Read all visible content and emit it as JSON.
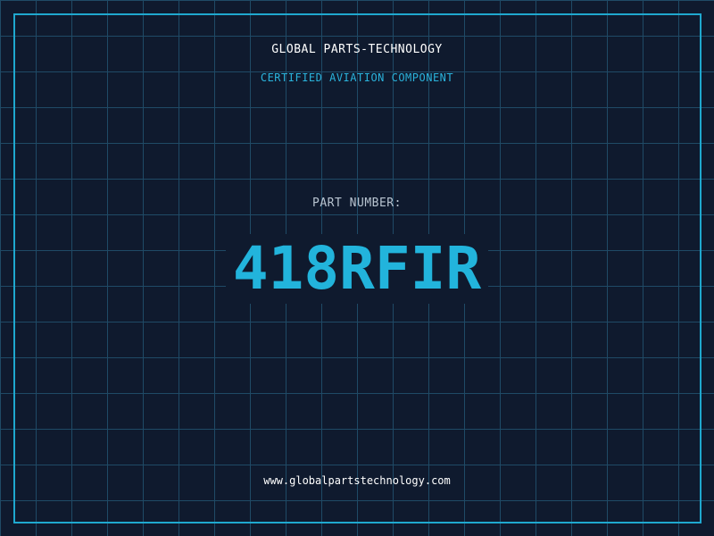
{
  "header": {
    "company": "GLOBAL PARTS-TECHNOLOGY",
    "tagline": "CERTIFIED AVIATION COMPONENT"
  },
  "part": {
    "label": "PART NUMBER:",
    "number": "418RFIR"
  },
  "footer": {
    "website": "www.globalpartstechnology.com"
  },
  "colors": {
    "background": "#0f1a2e",
    "grid": "#1f4a66",
    "accent": "#22b4dc",
    "frame": "#1fa8cf",
    "text": "#ffffff",
    "label": "#b8c4d0"
  }
}
